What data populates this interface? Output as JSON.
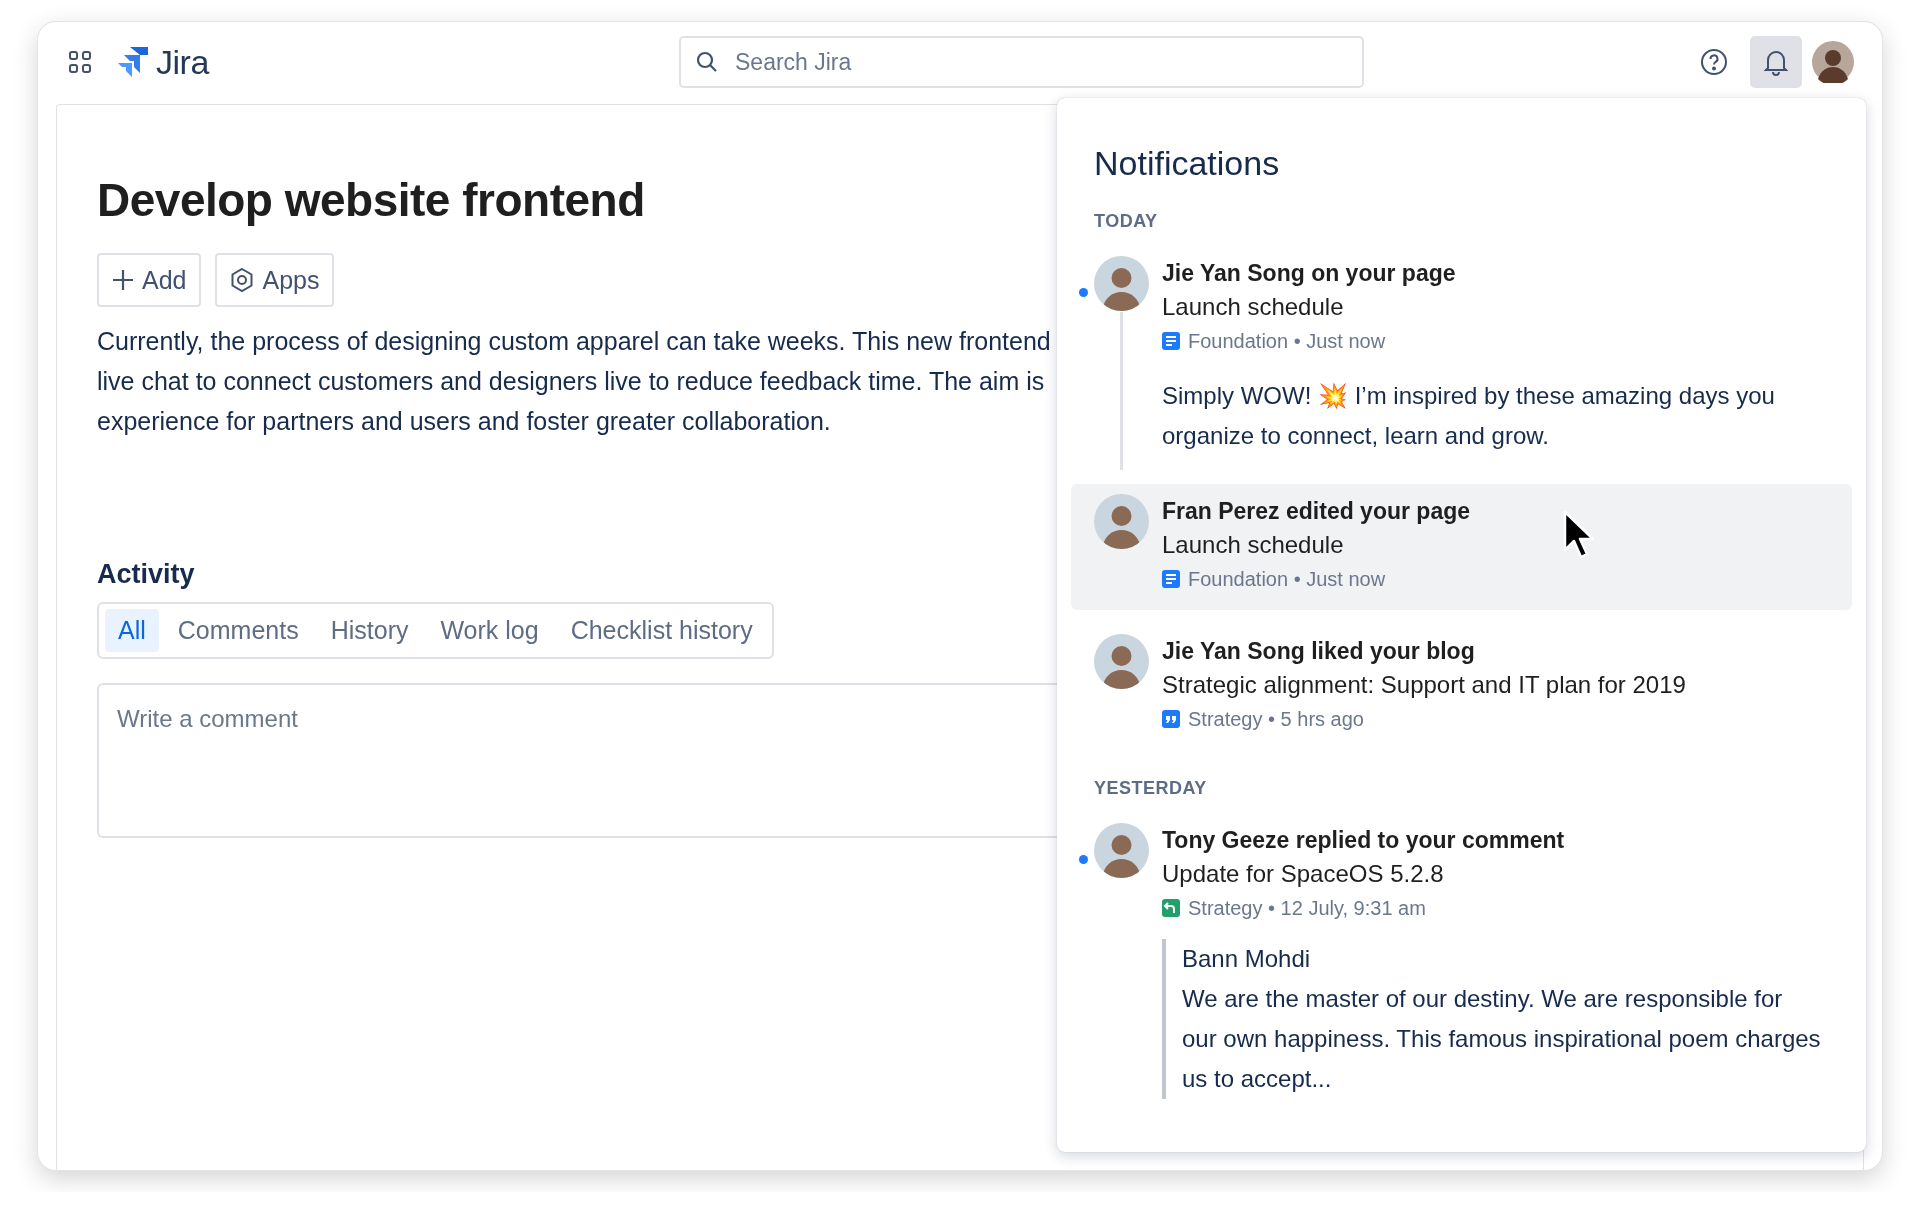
{
  "header": {
    "logo_text": "Jira",
    "search": {
      "placeholder": "Search Jira"
    },
    "notifications_button": {
      "selected": true
    }
  },
  "issue": {
    "title": "Develop website frontend",
    "actions": [
      {
        "kind": "add",
        "label": "Add"
      },
      {
        "kind": "apps",
        "label": "Apps"
      }
    ],
    "description_lines": [
      "Currently, the process of designing custom apparel can take weeks. This new frontend",
      "live chat to connect customers and designers live to reduce feedback time. The aim is",
      "experience for partners and users and foster greater collaboration."
    ]
  },
  "activity": {
    "heading": "Activity",
    "tabs": [
      {
        "label": "All",
        "selected": true
      },
      {
        "label": "Comments",
        "selected": false
      },
      {
        "label": "History",
        "selected": false
      },
      {
        "label": "Work log",
        "selected": false
      },
      {
        "label": "Checklist history",
        "selected": false
      }
    ],
    "comment": {
      "placeholder": "Write a comment"
    }
  },
  "notifications": {
    "title": "Notifications",
    "groups": [
      {
        "label": "TODAY",
        "items": [
          {
            "title": "Jie Yan Song on your page",
            "subtitle": "Launch schedule",
            "kind": "page",
            "meta": "Foundation • Just now",
            "unread": true,
            "hovered": false,
            "threaded": true,
            "body": "Simply WOW! 💥 I’m inspired by these amazing days you organize to connect, learn and grow."
          },
          {
            "title": "Fran Perez edited your page",
            "subtitle": "Launch schedule",
            "kind": "page",
            "meta": "Foundation • Just now",
            "unread": false,
            "hovered": true,
            "threaded": false
          },
          {
            "title": "Jie Yan Song liked your blog",
            "subtitle": "Strategic alignment: Support and IT plan for 2019",
            "kind": "blog",
            "meta": "Strategy • 5 hrs ago",
            "unread": false,
            "hovered": false,
            "threaded": false
          }
        ]
      },
      {
        "label": "YESTERDAY",
        "items": [
          {
            "title": "Tony Geeze replied to your comment",
            "subtitle": "Update for SpaceOS 5.2.8",
            "kind": "reply",
            "meta": "Strategy • 12 July, 9:31 am",
            "unread": true,
            "hovered": false,
            "threaded": false,
            "quote": {
              "author": "Bann Mohdi",
              "text": "We are the master of our destiny. We are responsible for our own happiness. This famous inspirational poem charges us to accept..."
            }
          }
        ]
      }
    ]
  }
}
